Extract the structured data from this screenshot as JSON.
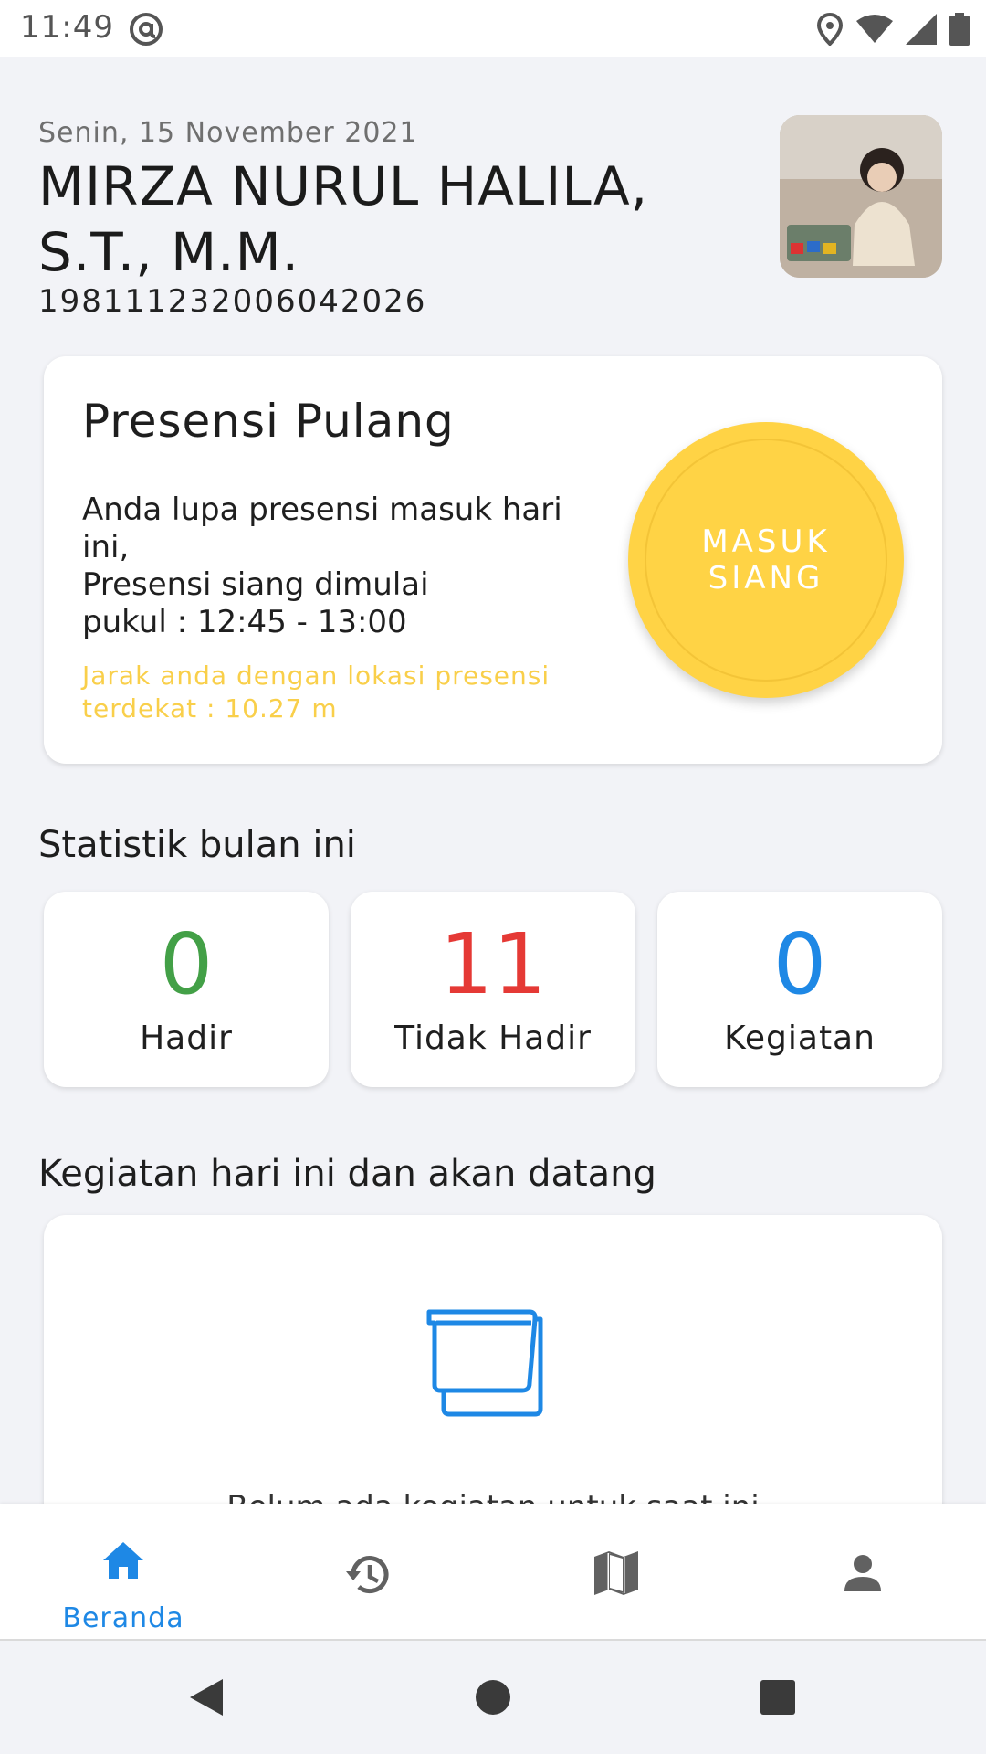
{
  "status_bar": {
    "time": "11:49",
    "icons": [
      "at-sign-icon",
      "location-icon",
      "wifi-icon",
      "signal-icon",
      "battery-icon"
    ]
  },
  "header": {
    "date": "Senin, 15 November 2021",
    "name_line1": "MIRZA NURUL HALILA,",
    "name_line2": "S.T., M.M.",
    "nip": "198111232006042026"
  },
  "presensi_card": {
    "title": "Presensi Pulang",
    "message_lines": [
      "Anda lupa presensi masuk hari",
      "ini,",
      "Presensi siang dimulai",
      "pukul : 12:45 - 13:00"
    ],
    "distance_line1": "Jarak anda dengan lokasi presensi",
    "distance_line2": "terdekat : 10.27 m",
    "button_line1": "MASUK",
    "button_line2": "SIANG"
  },
  "statistik": {
    "title": "Statistik bulan ini",
    "items": [
      {
        "value": "0",
        "label": "Hadir",
        "color": "#43A047"
      },
      {
        "value": "11",
        "label": "Tidak Hadir",
        "color": "#E53935"
      },
      {
        "value": "0",
        "label": "Kegiatan",
        "color": "#1E88E5"
      }
    ]
  },
  "kegiatan": {
    "title": "Kegiatan hari ini dan akan datang",
    "empty_text": "Belum ada kegiatan untuk saat ini",
    "empty_icon": "notepad-icon"
  },
  "bottom_nav": {
    "items": [
      {
        "label": "Beranda",
        "icon": "home-icon",
        "active": true
      },
      {
        "label": "",
        "icon": "history-icon",
        "active": false
      },
      {
        "label": "",
        "icon": "map-icon",
        "active": false
      },
      {
        "label": "",
        "icon": "person-icon",
        "active": false
      }
    ]
  },
  "colors": {
    "accent": "#1E88E5",
    "button_yellow": "#FFD345",
    "distance_text": "#F9CF4A",
    "background": "#F2F3F7"
  }
}
